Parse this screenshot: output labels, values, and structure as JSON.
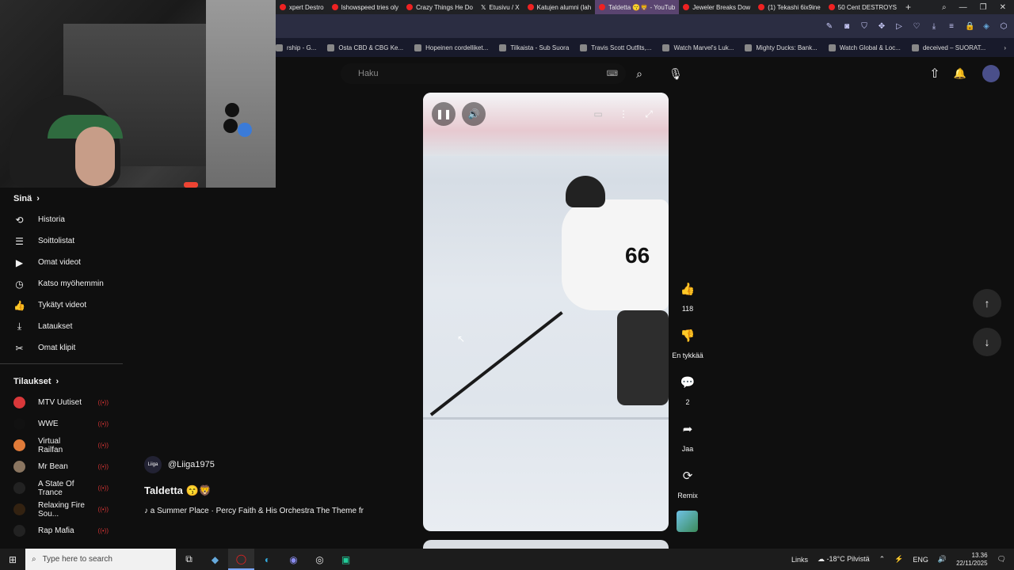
{
  "browser": {
    "tabs": [
      {
        "label": "xpert Destro",
        "icon": "youtube-icon",
        "active": false
      },
      {
        "label": "Ishowspeed tries oly",
        "icon": "youtube-icon",
        "active": false
      },
      {
        "label": "Crazy Things He Do",
        "icon": "youtube-icon",
        "active": false
      },
      {
        "label": "Etusivu / X",
        "icon": "x-icon",
        "active": false
      },
      {
        "label": "Katujen alumni (lah",
        "icon": "youtube-icon",
        "active": false
      },
      {
        "label": "Taldetta 😙🦁 - YouTub",
        "icon": "youtube-icon",
        "active": true
      },
      {
        "label": "Jeweler Breaks Dow",
        "icon": "youtube-icon",
        "active": false
      },
      {
        "label": "(1) Tekashi 6ix9ine",
        "icon": "youtube-icon",
        "active": false
      },
      {
        "label": "50 Cent DESTROYS",
        "icon": "youtube-icon",
        "active": false
      }
    ],
    "newtab": "+",
    "bookmarks": [
      {
        "label": "rship - G..."
      },
      {
        "label": "Osta CBD & CBG Ke..."
      },
      {
        "label": "Hopeinen cordelliket..."
      },
      {
        "label": "Tilkaista - Sub Suora"
      },
      {
        "label": "Travis Scott Outfits,..."
      },
      {
        "label": "Watch Marvel's Luk..."
      },
      {
        "label": "Mighty Ducks: Bank..."
      },
      {
        "label": "Watch Global & Loc..."
      },
      {
        "label": "deceived – SUORAT..."
      }
    ]
  },
  "search": {
    "placeholder": "Haku"
  },
  "sidebar": {
    "you_title": "Sinä",
    "items": [
      {
        "label": "Historia",
        "icon": "history-icon",
        "glyph": "⟲"
      },
      {
        "label": "Soittolistat",
        "icon": "playlists-icon",
        "glyph": "☰"
      },
      {
        "label": "Omat videot",
        "icon": "your-videos-icon",
        "glyph": "▶"
      },
      {
        "label": "Katso myöhemmin",
        "icon": "watch-later-icon",
        "glyph": "◷"
      },
      {
        "label": "Tykätyt videot",
        "icon": "liked-icon",
        "glyph": "👍"
      },
      {
        "label": "Lataukset",
        "icon": "download-icon",
        "glyph": "⤓"
      },
      {
        "label": "Omat klipit",
        "icon": "scissors-icon",
        "glyph": "✂"
      }
    ],
    "subs_title": "Tilaukset",
    "subscriptions": [
      {
        "label": "MTV Uutiset",
        "color": "#d9383a"
      },
      {
        "label": "WWE",
        "color": "#111111"
      },
      {
        "label": "Virtual Railfan",
        "color": "#e07b39"
      },
      {
        "label": "Mr Bean",
        "color": "#8a7560"
      },
      {
        "label": "A State Of Trance",
        "color": "#222222"
      },
      {
        "label": "Relaxing Fire Sou...",
        "color": "#332211"
      },
      {
        "label": "Rap Mafia",
        "color": "#222222"
      }
    ],
    "live_glyph": "((•))"
  },
  "short": {
    "channel": "@Liiga1975",
    "title": "Taldetta 😙🦁",
    "music": "♪ a Summer Place · Percy Faith & His Orchestra   The Theme fr",
    "jersey_number": "66"
  },
  "actions": {
    "like_count": "118",
    "dislike_label": "En tykkää",
    "comments_count": "2",
    "share_label": "Jaa",
    "remix_label": "Remix"
  },
  "taskbar": {
    "search_placeholder": "Type here to search",
    "links": "Links",
    "weather": "-18°C Pilvistä",
    "lang": "ENG",
    "time": "13.36",
    "date": "22/11/2025"
  }
}
